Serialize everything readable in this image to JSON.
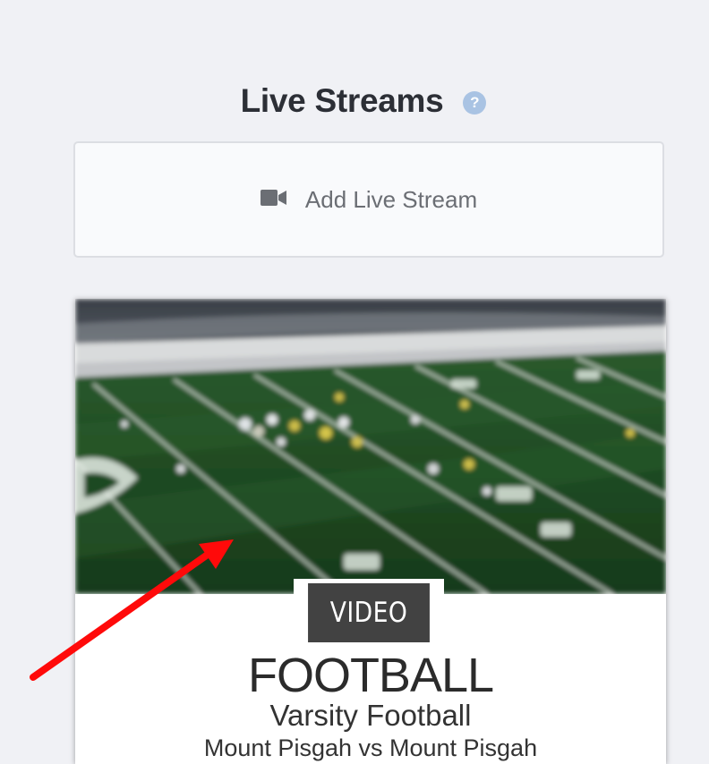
{
  "header": {
    "title": "Live Streams",
    "help_icon": "question-circle-icon",
    "help_symbol": "?"
  },
  "add_stream": {
    "label": "Add Live Stream",
    "icon": "video-camera-icon"
  },
  "stream_card": {
    "thumbnail_icon": "football-field-photo",
    "badge": "VIDEO",
    "sport": "FOOTBALL",
    "team_level": "Varsity Football",
    "matchup": "Mount Pisgah vs Mount Pisgah"
  },
  "annotation": {
    "color": "#ff0a0a",
    "icon": "red-arrow-annotation"
  },
  "colors": {
    "background": "#f0f1f5",
    "help_icon": "#a9c3e3",
    "badge": "#424242",
    "field_green": "#1f4a22"
  }
}
